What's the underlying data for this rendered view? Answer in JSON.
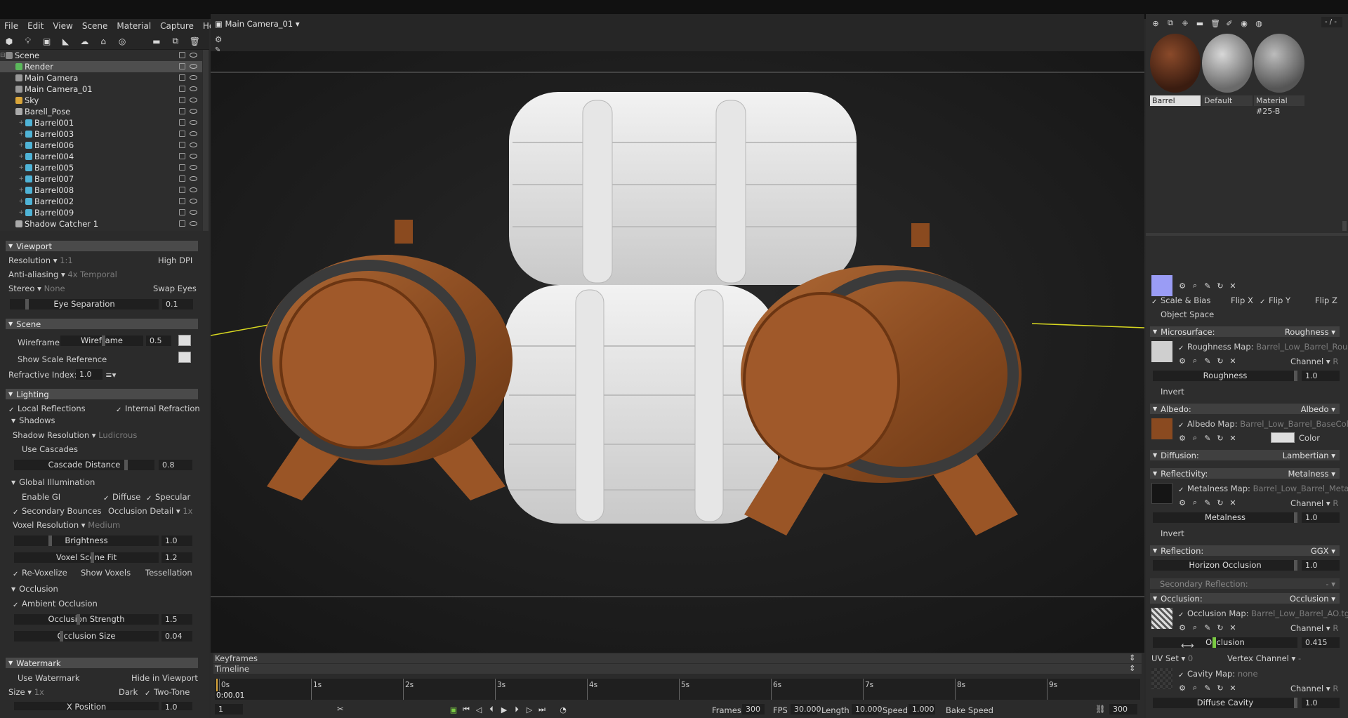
{
  "menu": [
    "File",
    "Edit",
    "View",
    "Scene",
    "Material",
    "Capture",
    "Help"
  ],
  "camera_selector": "Main Camera_01",
  "tree": [
    {
      "label": "Scene",
      "depth": 0,
      "icon": "scene",
      "color": "#888"
    },
    {
      "label": "Render",
      "depth": 1,
      "icon": "render",
      "color": "#5bb85b",
      "selected": true
    },
    {
      "label": "Main Camera",
      "depth": 1,
      "icon": "camera",
      "color": "#999"
    },
    {
      "label": "Main Camera_01",
      "depth": 1,
      "icon": "camera",
      "color": "#999"
    },
    {
      "label": "Sky",
      "depth": 1,
      "icon": "sky",
      "color": "#d9a53a"
    },
    {
      "label": "Barell_Pose",
      "depth": 1,
      "icon": "group",
      "color": "#aaa"
    },
    {
      "label": "Barrel001",
      "depth": 2,
      "icon": "mesh",
      "color": "#4fb3d6"
    },
    {
      "label": "Barrel003",
      "depth": 2,
      "icon": "mesh",
      "color": "#4fb3d6"
    },
    {
      "label": "Barrel006",
      "depth": 2,
      "icon": "mesh",
      "color": "#4fb3d6"
    },
    {
      "label": "Barrel004",
      "depth": 2,
      "icon": "mesh",
      "color": "#4fb3d6"
    },
    {
      "label": "Barrel005",
      "depth": 2,
      "icon": "mesh",
      "color": "#4fb3d6"
    },
    {
      "label": "Barrel007",
      "depth": 2,
      "icon": "mesh",
      "color": "#4fb3d6"
    },
    {
      "label": "Barrel008",
      "depth": 2,
      "icon": "mesh",
      "color": "#4fb3d6"
    },
    {
      "label": "Barrel002",
      "depth": 2,
      "icon": "mesh",
      "color": "#4fb3d6"
    },
    {
      "label": "Barrel009",
      "depth": 2,
      "icon": "mesh",
      "color": "#4fb3d6"
    },
    {
      "label": "Shadow Catcher 1",
      "depth": 1,
      "icon": "shadow",
      "color": "#aaa"
    }
  ],
  "viewport": {
    "title": "Viewport",
    "resolution_label": "Resolution",
    "resolution_value": "1:1",
    "high_dpi": "High DPI",
    "aa_label": "Anti-aliasing",
    "aa_value": "4x Temporal",
    "stereo_label": "Stereo",
    "stereo_value": "None",
    "swap_eyes": "Swap Eyes",
    "eye_sep_label": "Eye Separation",
    "eye_sep_value": "0.1"
  },
  "scene": {
    "title": "Scene",
    "wireframe": "Wireframe",
    "wireframe_slider": "Wireframe",
    "wireframe_value": "0.5",
    "show_scale": "Show Scale Reference",
    "refr_label": "Refractive Index:",
    "refr_value": "1.0"
  },
  "lighting": {
    "title": "Lighting",
    "local_refl": "Local Reflections",
    "internal_refr": "Internal Refraction",
    "shadows": "Shadows",
    "shadow_res_label": "Shadow Resolution",
    "shadow_res_value": "Ludicrous",
    "use_cascades": "Use Cascades",
    "cascade_label": "Cascade Distance",
    "cascade_value": "0.8",
    "gi": "Global Illumination",
    "enable_gi": "Enable GI",
    "diffuse": "Diffuse",
    "specular": "Specular",
    "secondary": "Secondary Bounces",
    "occ_detail_label": "Occlusion Detail",
    "occ_detail_value": "1x",
    "voxel_res_label": "Voxel Resolution",
    "voxel_res_value": "Medium",
    "brightness_label": "Brightness",
    "brightness_value": "1.0",
    "voxel_fit_label": "Voxel Scene Fit",
    "voxel_fit_value": "1.2",
    "revoxelize": "Re-Voxelize",
    "show_voxels": "Show Voxels",
    "tessellation": "Tessellation",
    "occlusion": "Occlusion",
    "ambient_occ": "Ambient Occlusion",
    "occ_strength_label": "Occlusion Strength",
    "occ_strength_value": "1.5",
    "occ_size_label": "Occlusion Size",
    "occ_size_value": "0.04"
  },
  "watermark": {
    "title": "Watermark",
    "use": "Use Watermark",
    "hide": "Hide in Viewport",
    "size_label": "Size",
    "size_value": "1x",
    "dark": "Dark",
    "two_tone": "Two-Tone",
    "xpos_label": "X Position",
    "xpos_value": "1.0"
  },
  "timeline": {
    "keyframes": "Keyframes",
    "timeline": "Timeline",
    "ticks": [
      "0s",
      "1s",
      "2s",
      "3s",
      "4s",
      "5s",
      "6s",
      "7s",
      "8s",
      "9s"
    ],
    "current_time": "0:00.01",
    "frame": "1",
    "frames_label": "Frames",
    "frames_value": "300",
    "fps_label": "FPS",
    "fps_value": "30.000",
    "length_label": "Length",
    "length_value": "10.000",
    "speed_label": "Speed",
    "speed_value": "1.000",
    "bake_speed": "Bake Speed",
    "end_frame": "300"
  },
  "materials": {
    "page_counter": "- / -",
    "items": [
      {
        "name": "Barrel",
        "selected": true
      },
      {
        "name": "Default"
      },
      {
        "name": "Material #25-B"
      }
    ]
  },
  "props": {
    "scale_bias": "Scale & Bias",
    "flip_x": "Flip X",
    "flip_y": "Flip Y",
    "flip_z": "Flip Z",
    "object_space": "Object Space",
    "microsurface": "Microsurface:",
    "microsurface_value": "Roughness",
    "roughness_map_label": "Roughness Map:",
    "roughness_map_file": "Barrel_Low_Barrel_Roug",
    "channel_label": "Channel",
    "channel_value": "R",
    "roughness_label": "Roughness",
    "roughness_value": "1.0",
    "invert": "Invert",
    "albedo": "Albedo:",
    "albedo_value": "Albedo",
    "albedo_map_label": "Albedo Map:",
    "albedo_map_file": "Barrel_Low_Barrel_BaseCol",
    "color_label": "Color",
    "diffusion": "Diffusion:",
    "diffusion_value": "Lambertian",
    "reflectivity": "Reflectivity:",
    "reflectivity_value": "Metalness",
    "metal_map_label": "Metalness Map:",
    "metal_map_file": "Barrel_Low_Barrel_Metal",
    "metalness_label": "Metalness",
    "metalness_value": "1.0",
    "reflection": "Reflection:",
    "reflection_value": "GGX",
    "horizon_label": "Horizon Occlusion",
    "horizon_value": "1.0",
    "secondary_refl": "Secondary Reflection:",
    "secondary_refl_value": "-",
    "occlusion": "Occlusion:",
    "occlusion_value": "Occlusion",
    "occ_map_label": "Occlusion Map:",
    "occ_map_file": "Barrel_Low_Barrel_AO.tg",
    "occ_slider_label": "Occlusion",
    "occ_slider_value": "0.415",
    "uv_set_label": "UV Set",
    "uv_set_value": "0",
    "vertex_channel": "Vertex Channel",
    "vertex_channel_value": "-",
    "cavity_map_label": "Cavity Map:",
    "cavity_map_file": "none",
    "diffuse_cavity_label": "Diffuse Cavity",
    "diffuse_cavity_value": "1.0"
  }
}
